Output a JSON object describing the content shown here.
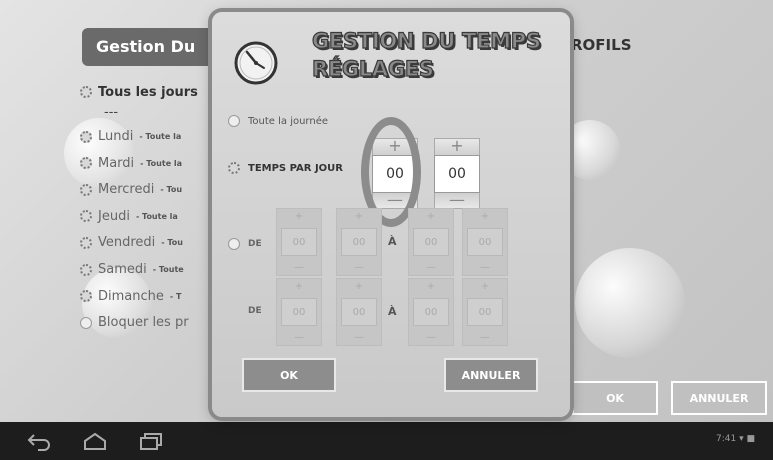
{
  "background": {
    "header_title": "Gestion Du",
    "profiles_label": "ROFILS",
    "rows": [
      {
        "day": "Tous les jours",
        "detail": ""
      },
      {
        "day": "Lundi",
        "detail": "- Toute la"
      },
      {
        "day": "Mardi",
        "detail": "- Toute la"
      },
      {
        "day": "Mercredi",
        "detail": "- Tou"
      },
      {
        "day": "Jeudi",
        "detail": "- Toute la"
      },
      {
        "day": "Vendredi",
        "detail": "- Tou"
      },
      {
        "day": "Samedi",
        "detail": "- Toute"
      },
      {
        "day": "Dimanche",
        "detail": "- T"
      }
    ],
    "dots": "---",
    "block_label": "Bloquer les pr",
    "ok_label": "OK",
    "cancel_label": "ANNULER"
  },
  "dialog": {
    "icon": "clock-icon",
    "title_line1": "GESTION DU TEMPS",
    "title_line2": "RÉGLAGES",
    "option_all_day": "Toute la journée",
    "option_time_per_day": "TEMPS PAR JOUR",
    "hours_value": "00",
    "minutes_value": "00",
    "plus_symbol": "+",
    "minus_symbol": "—",
    "range_from": "DE",
    "range_to": "À",
    "range_row1": [
      "00",
      "00",
      "00",
      "00"
    ],
    "range_row2": [
      "00",
      "00",
      "00",
      "00"
    ],
    "ok_label": "OK",
    "cancel_label": "ANNULER"
  },
  "navbar": {
    "status": "7:41 ▾ ■"
  },
  "colors": {
    "dialog_bg": "#d4d4d4",
    "navbar_bg": "#1d1d1d",
    "button_bg": "#8d8d8d"
  }
}
